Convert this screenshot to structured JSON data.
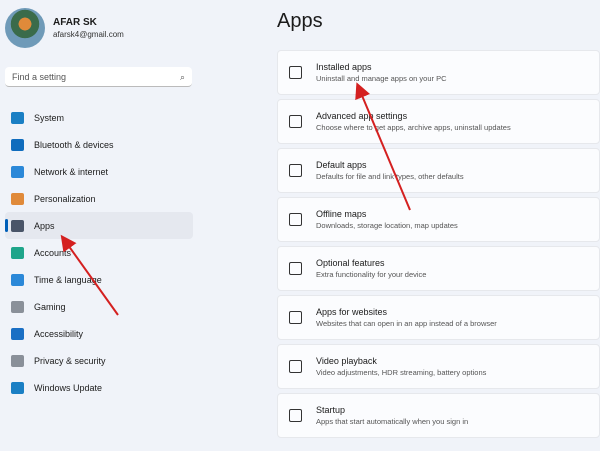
{
  "profile": {
    "name": "AFAR SK",
    "email": "afarsk4@gmail.com"
  },
  "search": {
    "placeholder": "Find a setting",
    "icon": "search-icon"
  },
  "nav": [
    {
      "label": "System",
      "color": "#1a7fc4"
    },
    {
      "label": "Bluetooth & devices",
      "color": "#0f6cbd"
    },
    {
      "label": "Network & internet",
      "color": "#2b88d8"
    },
    {
      "label": "Personalization",
      "color": "#e08a3a"
    },
    {
      "label": "Apps",
      "color": "#4a5568"
    },
    {
      "label": "Accounts",
      "color": "#1fa58a"
    },
    {
      "label": "Time & language",
      "color": "#2b88d8"
    },
    {
      "label": "Gaming",
      "color": "#8a9099"
    },
    {
      "label": "Accessibility",
      "color": "#1a6fc4"
    },
    {
      "label": "Privacy & security",
      "color": "#8a9099"
    },
    {
      "label": "Windows Update",
      "color": "#1a7fc4"
    }
  ],
  "page_title": "Apps",
  "cards": [
    {
      "title": "Installed apps",
      "desc": "Uninstall and manage apps on your PC"
    },
    {
      "title": "Advanced app settings",
      "desc": "Choose where to get apps, archive apps, uninstall updates"
    },
    {
      "title": "Default apps",
      "desc": "Defaults for file and link types, other defaults"
    },
    {
      "title": "Offline maps",
      "desc": "Downloads, storage location, map updates"
    },
    {
      "title": "Optional features",
      "desc": "Extra functionality for your device"
    },
    {
      "title": "Apps for websites",
      "desc": "Websites that can open in an app instead of a browser"
    },
    {
      "title": "Video playback",
      "desc": "Video adjustments, HDR streaming, battery options"
    },
    {
      "title": "Startup",
      "desc": "Apps that start automatically when you sign in"
    }
  ]
}
